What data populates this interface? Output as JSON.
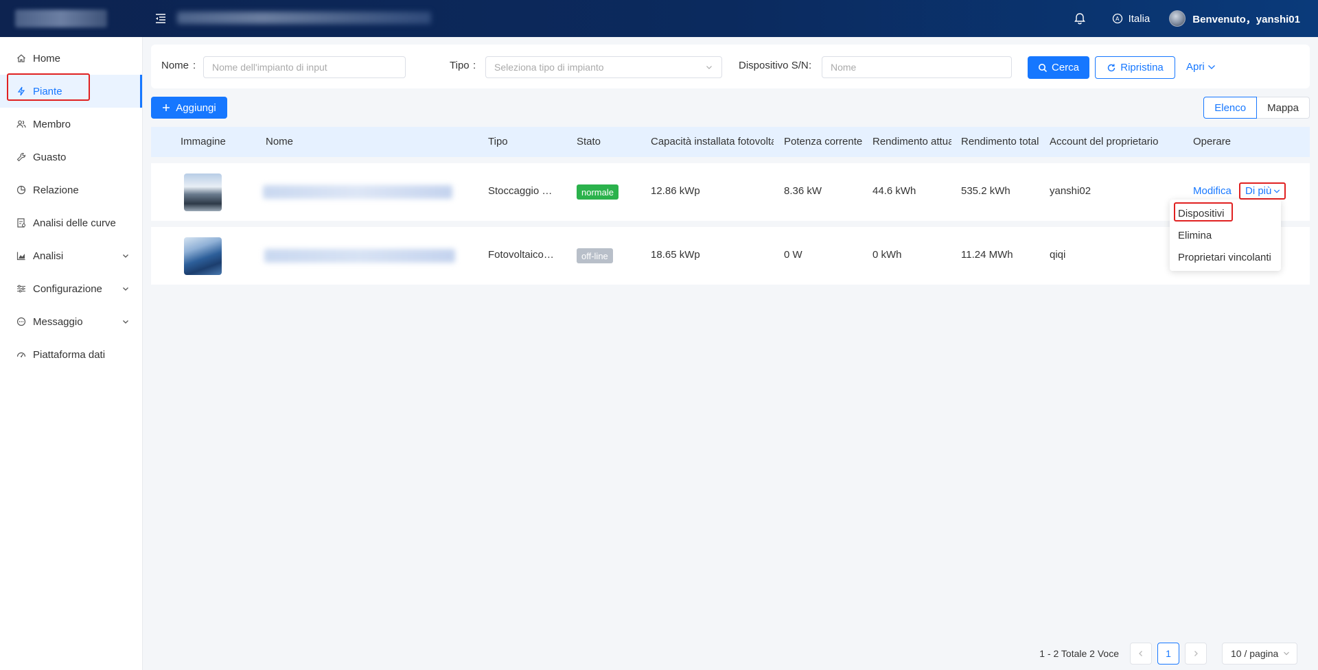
{
  "header": {
    "language": "Italia",
    "welcome": "Benvenuto，yanshi01"
  },
  "sidebar": {
    "items": [
      {
        "label": "Home",
        "icon": "home-icon"
      },
      {
        "label": "Piante",
        "icon": "lightning-icon"
      },
      {
        "label": "Membro",
        "icon": "users-icon"
      },
      {
        "label": "Guasto",
        "icon": "wrench-icon"
      },
      {
        "label": "Relazione",
        "icon": "pie-chart-icon"
      },
      {
        "label": "Analisi delle curve",
        "icon": "report-icon"
      },
      {
        "label": "Analisi",
        "icon": "area-chart-icon"
      },
      {
        "label": "Configurazione",
        "icon": "sliders-icon"
      },
      {
        "label": "Messaggio",
        "icon": "message-icon"
      },
      {
        "label": "Piattaforma dati",
        "icon": "dashboard-icon"
      }
    ],
    "active_index": 1
  },
  "search": {
    "name_label": "Nome",
    "name_placeholder": "Nome dell'impianto di input",
    "type_label": "Tipo",
    "type_placeholder": "Seleziona tipo di impianto",
    "device_label": "Dispositivo S/N",
    "device_placeholder": "Nome",
    "search_btn": "Cerca",
    "reset_btn": "Ripristina",
    "expand_link": "Apri"
  },
  "toolbar": {
    "add_btn": "Aggiungi",
    "view_list": "Elenco",
    "view_map": "Mappa"
  },
  "table": {
    "columns": [
      "Immagine",
      "Nome",
      "Tipo",
      "Stato",
      "Capacità installata fotovoltaica",
      "Potenza corrente",
      "Rendimento attuale",
      "Rendimento totale",
      "Account del proprietario",
      "Operare"
    ],
    "rows": [
      {
        "tipo": "Stoccaggio e…",
        "stato": "normale",
        "capacita": "12.86 kWp",
        "potenza": "8.36 kW",
        "rend_attuale": "44.6 kWh",
        "rend_totale": "535.2 kWh",
        "account": "yanshi02"
      },
      {
        "tipo": "Fotovoltaico…",
        "stato": "off-line",
        "capacita": "18.65 kWp",
        "potenza": "0 W",
        "rend_attuale": "0 kWh",
        "rend_totale": "11.24 MWh",
        "account": "qiqi"
      }
    ],
    "op_edit": "Modifica",
    "op_more": "Di più"
  },
  "more_menu": {
    "items": [
      "Dispositivi",
      "Elimina",
      "Proprietari vincolanti"
    ]
  },
  "pagination": {
    "summary": "1 - 2 Totale 2 Voce",
    "current_page": "1",
    "page_size": "10 / pagina"
  },
  "colors": {
    "accent": "#1677ff",
    "header_bg": "#0b2a5e",
    "status_normal": "#2bb24c",
    "status_offline": "#b8bfc9",
    "highlight_box": "#e02020"
  }
}
